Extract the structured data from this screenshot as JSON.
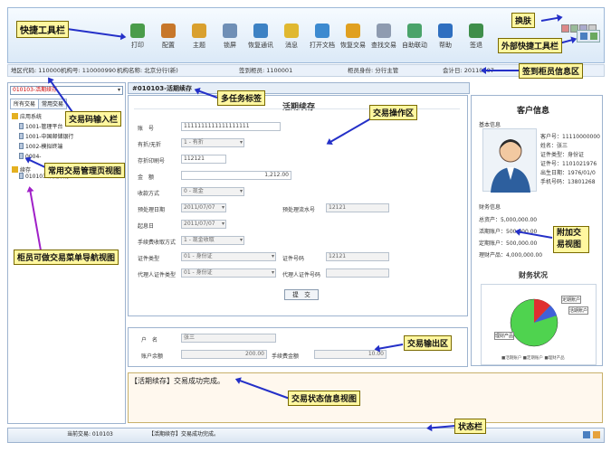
{
  "toolbar": {
    "buttons": [
      {
        "label": "打印",
        "icon": "printer-icon",
        "color": "#4a9c4a"
      },
      {
        "label": "配置",
        "icon": "gear-icon",
        "color": "#c7772a"
      },
      {
        "label": "主题",
        "icon": "theme-icon",
        "color": "#d9a02e"
      },
      {
        "label": "锁屏",
        "icon": "lock-screen-icon",
        "color": "#6f8fb6"
      },
      {
        "label": "恢复通讯",
        "icon": "reconnect-icon",
        "color": "#3d82c4"
      },
      {
        "label": "消息",
        "icon": "message-icon",
        "color": "#e0b830"
      },
      {
        "label": "打开文档",
        "icon": "open-doc-icon",
        "color": "#3c8ad0"
      },
      {
        "label": "恢复交易",
        "icon": "restore-trade-icon",
        "color": "#e0a020"
      },
      {
        "label": "查找交易",
        "icon": "find-trade-icon",
        "color": "#8e9bb0"
      },
      {
        "label": "自助联动",
        "icon": "self-service-icon",
        "color": "#4aa36a"
      },
      {
        "label": "帮助",
        "icon": "help-icon",
        "color": "#2f6fc0"
      },
      {
        "label": "签退",
        "icon": "sign-out-icon",
        "color": "#3f8e4a"
      }
    ]
  },
  "info": {
    "area": "地区代码: 110000",
    "org": "机构号: 110000990",
    "orgname": "机构名称: 北京分行(新)",
    "signin": "签到柜员: 1100001",
    "role": "柜员身份: 分行主管",
    "date": "会计日: 20110707"
  },
  "left": {
    "trade_code": "010103-活期续存",
    "tabs": [
      "所有交易",
      "常用交易"
    ],
    "tree": [
      {
        "label": "应用系统",
        "type": "folder",
        "level": 0
      },
      {
        "label": "1001-管理平台",
        "type": "doc",
        "level": 1
      },
      {
        "label": "1001-中国邮储银行",
        "type": "doc",
        "level": 1
      },
      {
        "label": "1002-模拟终端",
        "type": "doc",
        "level": 1
      },
      {
        "label": "0004-",
        "type": "doc",
        "level": 1
      },
      {
        "label": "续存",
        "type": "folder",
        "level": 0
      },
      {
        "label": "010103-活期续存",
        "type": "doc",
        "level": 1
      }
    ]
  },
  "main": {
    "tab_label": "#010103-活期续存",
    "form_title": "活期续存",
    "fields": {
      "account_label": "账　号",
      "account": "1111111111111111111",
      "book_label": "有折/无折",
      "book": "1 - 有折",
      "bookno_label": "存折印刷号",
      "bookno": "112121",
      "amount_label": "金　额",
      "amount": "1,212.00",
      "method_label": "收款方式",
      "method": "0 - 现金",
      "date1_label": "预处理日期",
      "date1": "2011/07/07",
      "serial_label": "预处理流水号",
      "serial": "12121",
      "start_label": "起息日",
      "start": "2011/07/07",
      "fee_label": "手续费收取方式",
      "fee": "1 - 现金收取",
      "idtype_label": "证件类型",
      "idtype": "01 - 身份证",
      "idno_label": "证件号码",
      "idno": "12121",
      "agent_idtype_label": "代理人证件类型",
      "agent_idtype": "01 - 身份证",
      "agent_idno_label": "代理人证件号码",
      "agent_idno": ""
    },
    "submit": "提　交",
    "output": {
      "name_label": "户　名",
      "name": "张三",
      "balance_label": "账户余额",
      "balance": "200.00",
      "feeamt_label": "手续费金额",
      "feeamt": "10.00"
    }
  },
  "customer": {
    "title": "客户信息",
    "basic": "基本信息",
    "lines": [
      "客户号：11110000000",
      "姓名：张三",
      "证件类型：身份证",
      "证件号：1101021976",
      "出生日期：1976/01/0",
      "手机号码：13801268"
    ],
    "finance": "财务信息",
    "fin_lines": [
      "总资产：5,000,000.00",
      "活期账户：500,000.00",
      "定期账户：500,000.00",
      "理财产品：4,000,000.00"
    ],
    "fin_status": "财务状况",
    "pie_labels": [
      "定期账户",
      "活期账户",
      "理财产品"
    ],
    "legend": "■活期账户 ■定期账户 ■理财产品"
  },
  "message": "【活期续存】交易成功完成。",
  "status": {
    "current": "当前交易: 010103",
    "msg": "【活期续存】交易成功完成。"
  },
  "annotations": {
    "quick_toolbar": "快捷工具栏",
    "skin": "换肤",
    "external_toolbar": "外部快捷工具栏",
    "signin_info": "签到柜员信息区",
    "multi_tab": "多任务标签",
    "trade_input": "交易码输入栏",
    "op_area": "交易操作区",
    "common_view": "常用交易管理页视图",
    "teller_nav": "柜员可做交易菜单导航视图",
    "extra_view": "附加交易视图",
    "output_area": "交易输出区",
    "status_view": "交易状态信息视图",
    "status_bar": "状态栏"
  }
}
